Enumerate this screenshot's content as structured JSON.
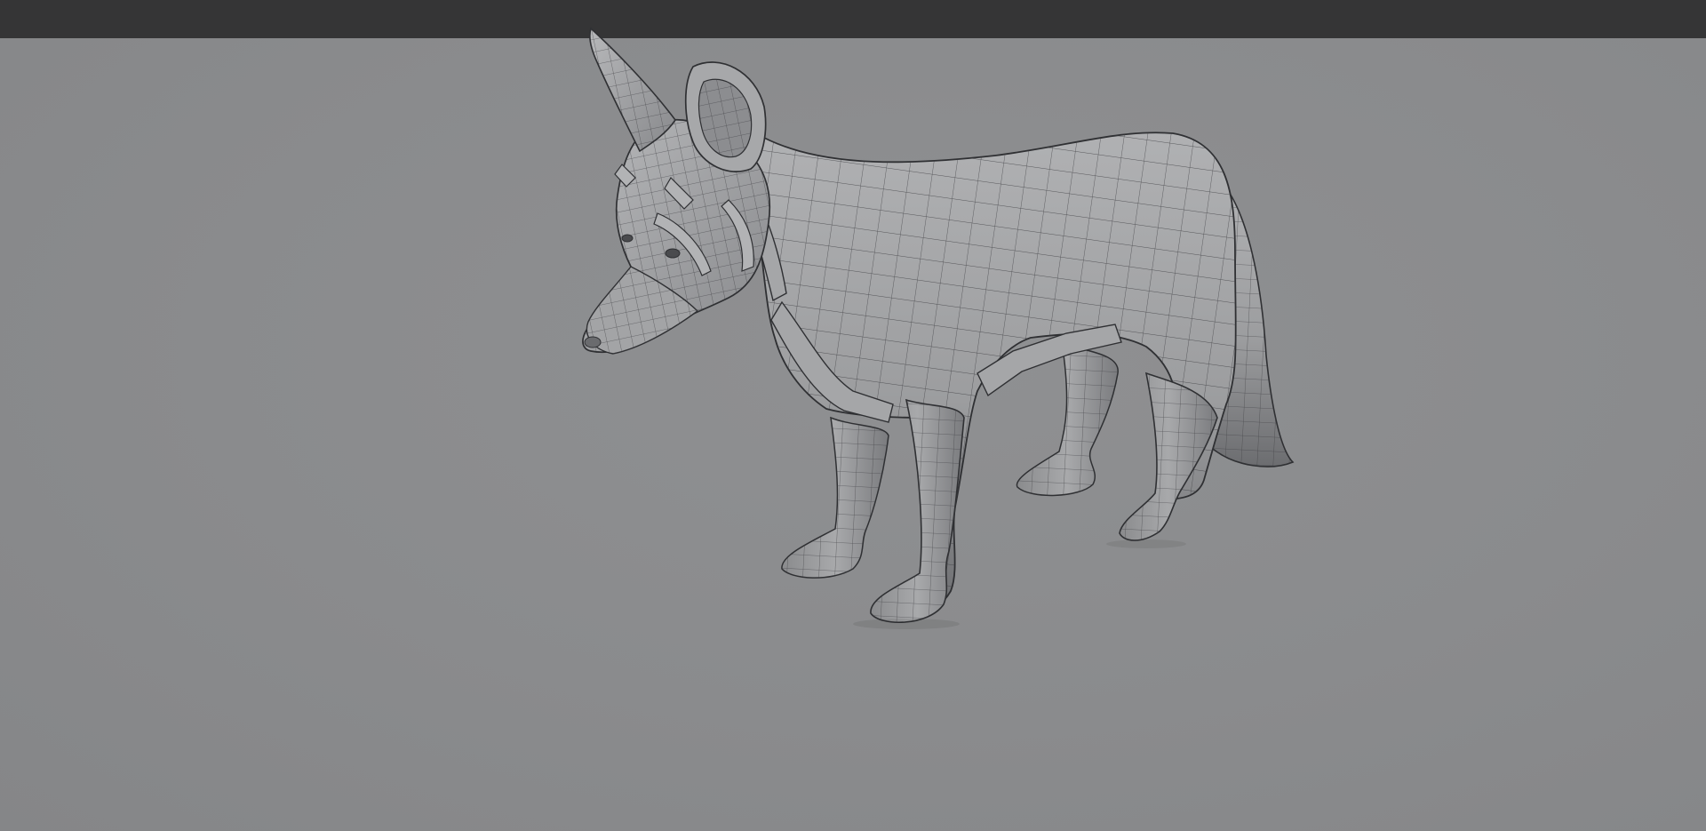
{
  "app": {
    "topbar_color": "#353536",
    "viewport_color": "#8a8b8d"
  },
  "viewport": {
    "model": {
      "name": "wolf-wireframe-model",
      "shading": "gray-solid-with-wireframe",
      "base_color": "#9a9a9c",
      "wire_color": "#2f3033"
    }
  }
}
